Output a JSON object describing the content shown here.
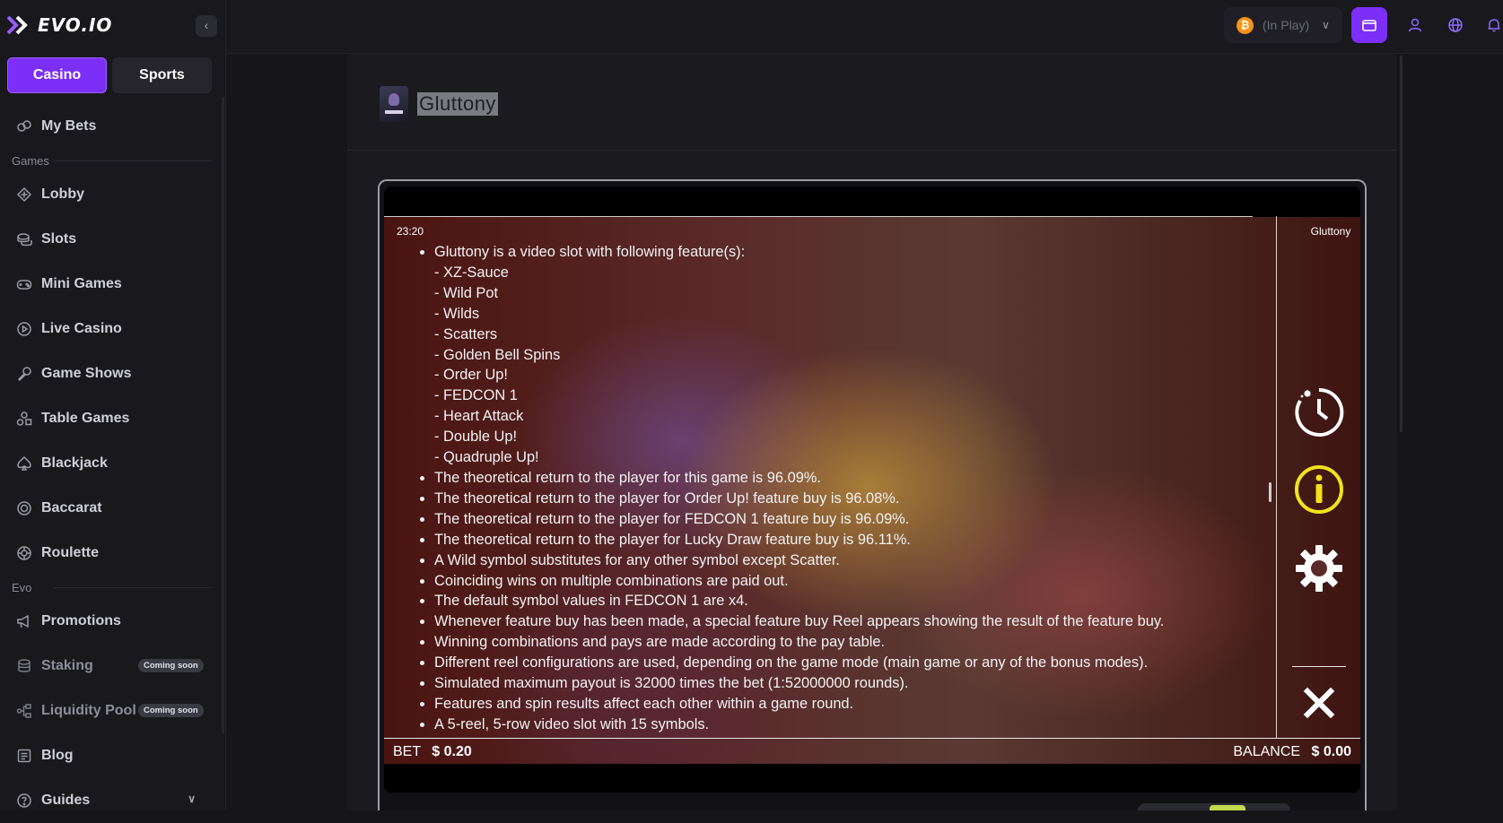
{
  "brand": {
    "name": "EVO.IO"
  },
  "sidebar": {
    "collapse_label": "‹",
    "tabs": [
      {
        "label": "Casino",
        "active": true
      },
      {
        "label": "Sports",
        "active": false
      }
    ],
    "my_bets": "My Bets",
    "games_section": "Games",
    "games": [
      {
        "label": "Lobby",
        "icon": "diamond-icon"
      },
      {
        "label": "Slots",
        "icon": "coins-icon"
      },
      {
        "label": "Mini Games",
        "icon": "gamepad-icon"
      },
      {
        "label": "Live Casino",
        "icon": "play-circle-icon"
      },
      {
        "label": "Game Shows",
        "icon": "microphone-icon"
      },
      {
        "label": "Table Games",
        "icon": "shapes-icon"
      },
      {
        "label": "Blackjack",
        "icon": "spade-icon"
      },
      {
        "label": "Baccarat",
        "icon": "chip-icon"
      },
      {
        "label": "Roulette",
        "icon": "roulette-icon"
      }
    ],
    "evo_section": "Evo",
    "evo": [
      {
        "label": "Promotions",
        "icon": "megaphone-icon"
      },
      {
        "label": "Staking",
        "icon": "database-icon",
        "badge": "Coming soon"
      },
      {
        "label": "Liquidity Pool",
        "icon": "network-icon",
        "badge": "Coming soon"
      },
      {
        "label": "Blog",
        "icon": "document-icon"
      },
      {
        "label": "Guides",
        "icon": "help-icon"
      }
    ]
  },
  "header": {
    "wallet_label": "(In Play)",
    "currency_symbol": "₿"
  },
  "game": {
    "title": "Gluttony",
    "time": "23:20",
    "name_label": "Gluttony",
    "intro": "Gluttony is a video slot with following feature(s):",
    "features": [
      "- XZ-Sauce",
      "- Wild Pot",
      "- Wilds",
      "- Scatters",
      "- Golden Bell Spins",
      "- Order Up!",
      "- FEDCON 1",
      "- Heart Attack",
      "- Double Up!",
      "- Quadruple Up!"
    ],
    "rules": [
      "The theoretical return to the player for this game is 96.09%.",
      "The theoretical return to the player for Order Up! feature buy is 96.08%.",
      "The theoretical return to the player for FEDCON 1 feature buy is 96.09%.",
      "The theoretical return to the player for Lucky Draw feature buy is 96.11%.",
      "A Wild symbol substitutes for any other symbol except Scatter.",
      "Coinciding wins on multiple combinations are paid out.",
      "The default symbol values in FEDCON 1 are x4.",
      "Whenever feature buy has been made, a special feature buy Reel appears showing the result of the feature buy.",
      "Winning combinations and pays are made according to the pay table.",
      "Different reel configurations are used, depending on the game mode (main game or any of the bonus modes).",
      "Simulated maximum payout is 32000 times the bet (1:52000000 rounds).",
      "Features and spin results affect each other within a game round.",
      "A 5-reel, 5-row video slot with 15 symbols."
    ],
    "bet_label": "BET",
    "bet_value": "$ 0.20",
    "balance_label": "BALANCE",
    "balance_value": "$ 0.00",
    "colors": {
      "accent": "#7b2ff7",
      "info_yellow": "#f2e21c"
    }
  }
}
